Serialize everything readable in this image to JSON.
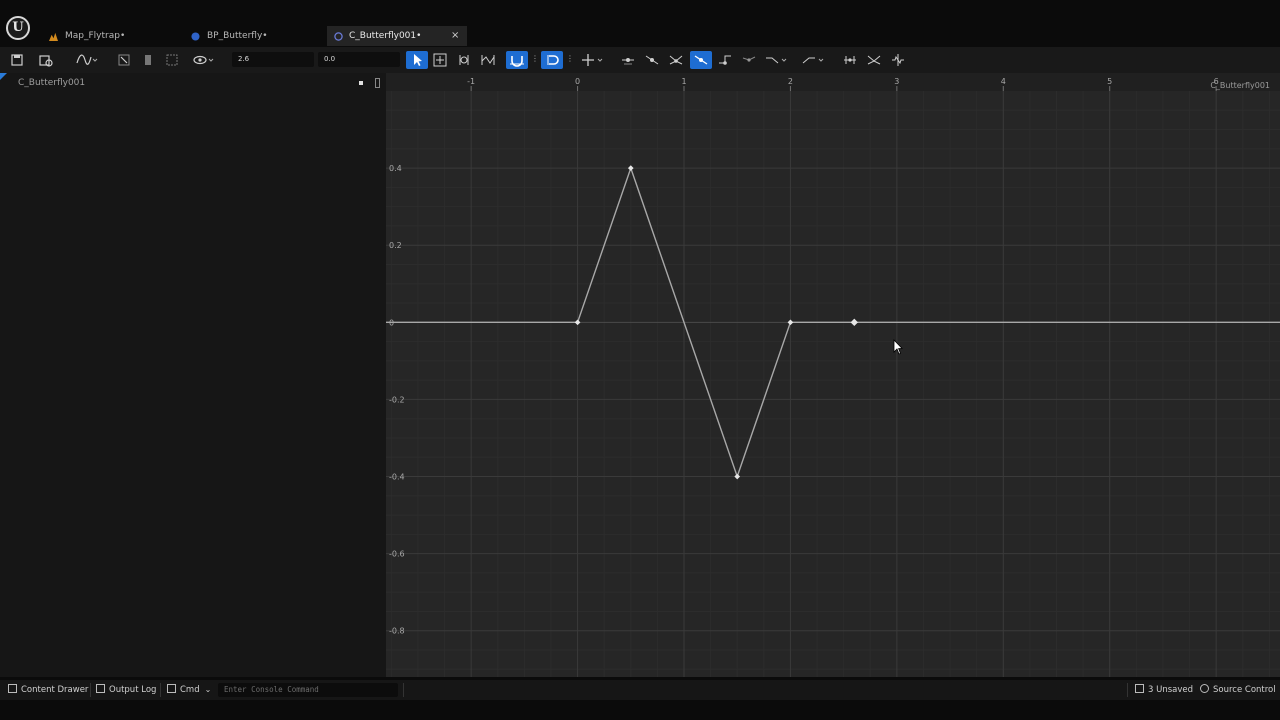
{
  "tabs": [
    {
      "label": "Map_Flytrap•",
      "icon": "level-icon",
      "active": false
    },
    {
      "label": "BP_Butterfly•",
      "icon": "blueprint-icon",
      "active": false
    },
    {
      "label": "C_Butterfly001•",
      "icon": "curve-icon",
      "active": true
    }
  ],
  "toolbar": {
    "time_value": "2.6",
    "value_value": "0.0"
  },
  "left_panel": {
    "curve_name": "C_Butterfly001"
  },
  "graph": {
    "title": "C_Butterfly001",
    "x_ticks": [
      "-1",
      "0",
      "1",
      "2",
      "3",
      "4",
      "5",
      "6"
    ],
    "y_ticks": [
      "0.4",
      "0.2",
      "0",
      "-0.2",
      "-0.4",
      "-0.6",
      "-0.8"
    ]
  },
  "chart_data": {
    "type": "line",
    "title": "C_Butterfly001",
    "xlabel": "",
    "ylabel": "",
    "xlim": [
      -1.8,
      6.6
    ],
    "ylim": [
      -0.92,
      0.6
    ],
    "grid": true,
    "keys": [
      {
        "x": 0.0,
        "y": 0.0
      },
      {
        "x": 0.5,
        "y": 0.4
      },
      {
        "x": 1.5,
        "y": -0.4
      },
      {
        "x": 2.0,
        "y": 0.0
      },
      {
        "x": 2.6,
        "y": 0.0
      }
    ],
    "line_color": "#a8a8a8"
  },
  "status": {
    "content_drawer": "Content Drawer",
    "output_log": "Output Log",
    "cmd": "Cmd",
    "console_placeholder": "Enter Console Command",
    "unsaved": "3 Unsaved",
    "source_control": "Source Control"
  },
  "colors": {
    "accent": "#1e6dd2",
    "graph_bg": "#262626",
    "panel_bg": "#161616"
  }
}
